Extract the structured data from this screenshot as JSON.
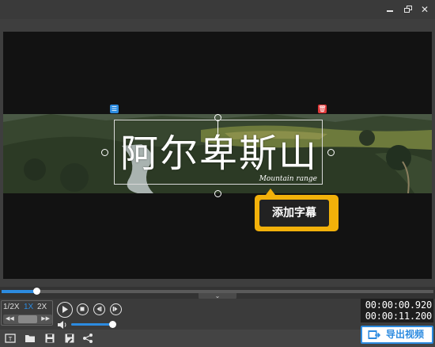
{
  "window": {
    "minimize_icon": "minimize-icon",
    "restore_icon": "restore-icon",
    "close_icon": "close-icon"
  },
  "subtitle": {
    "main_text": "阿尔卑斯山",
    "sub_text": "Mountain range",
    "edit_icon": "list-icon",
    "delete_icon": "trash-icon"
  },
  "callout": {
    "label": "添加字幕"
  },
  "playback": {
    "progress_fraction": 0.08,
    "speeds": [
      "1/2X",
      "1X",
      "2X"
    ],
    "selected_speed": "1X",
    "volume_fraction": 1.0,
    "current_time": "00:00:00.920",
    "total_time": "00:00:11.200"
  },
  "toolbar": {
    "icons": [
      "subtitle-icon",
      "folder-icon",
      "save-icon",
      "save-as-icon",
      "share-icon"
    ],
    "export_label": "导出视频"
  },
  "colors": {
    "accent": "#2c8be0",
    "callout": "#f2b10a",
    "delete": "#e03a3a"
  }
}
